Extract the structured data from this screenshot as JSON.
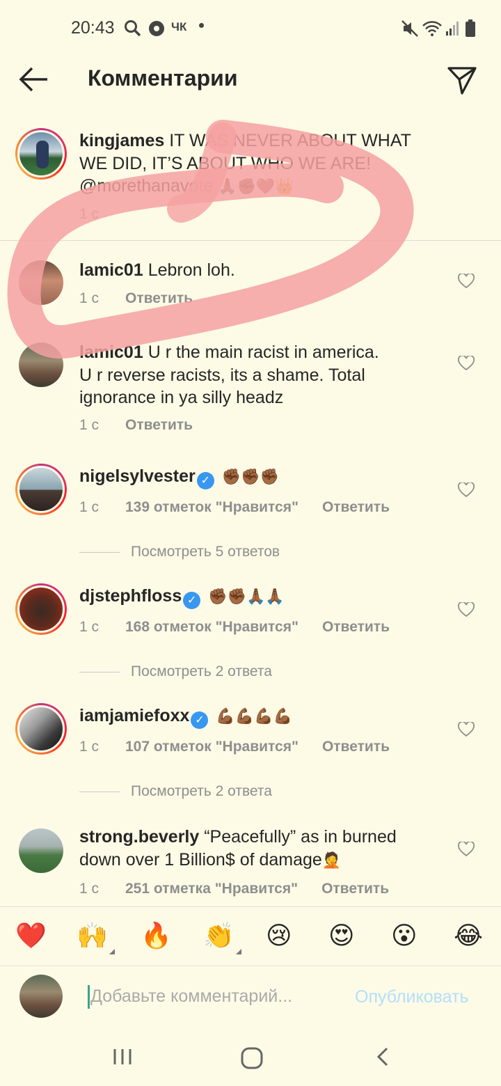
{
  "status_bar": {
    "time": "20:43",
    "carrier_label": "ЧК"
  },
  "header": {
    "title": "Комментарии"
  },
  "caption": {
    "username": "kingjames",
    "text_line1": " IT WAS NEVER ABOUT WHAT",
    "text_line2": "WE DID, IT’S ABOUT WHO WE ARE!",
    "text_line3": "@morethanavote ",
    "emojis": "🙏🏾✊🏾🤎👑",
    "time": "1 с"
  },
  "comments": [
    {
      "username": "lamic01",
      "text": " Lebron loh.",
      "time": "1 с",
      "reply": "Ответить"
    },
    {
      "username": "lamic01",
      "text_line1": " U r the main racist in america.",
      "text_line2": "U r reverse racists, its a shame. Total",
      "text_line3": "ignorance in ya silly headz",
      "time": "1 с",
      "reply": "Ответить"
    },
    {
      "username": "nigelsylvester",
      "verified": true,
      "emojis": "✊🏾✊🏾✊🏾",
      "time": "1 с",
      "likes": "139 отметок \"Нравится\"",
      "reply": "Ответить",
      "view_replies": "Посмотреть 5 ответов"
    },
    {
      "username": "djstephfloss",
      "verified": true,
      "emojis": "✊🏾✊🏾🙏🏾🙏🏾",
      "time": "1 с",
      "likes": "168 отметок \"Нравится\"",
      "reply": "Ответить",
      "view_replies": "Посмотреть 2 ответа"
    },
    {
      "username": "iamjamiefoxx",
      "verified": true,
      "emojis": "💪🏾💪🏾💪🏾💪🏾",
      "time": "1 с",
      "likes": "107 отметок \"Нравится\"",
      "reply": "Ответить",
      "view_replies": "Посмотреть 2 ответа"
    },
    {
      "username": "strong.beverly",
      "text_line1": " “Peacefully” as in burned",
      "text_line2": "down over 1 Billion$ of damage",
      "text_emoji": "🤦",
      "time": "1 с",
      "likes": "251 отметка \"Нравится\"",
      "reply": "Ответить"
    }
  ],
  "emoji_bar": [
    "❤️",
    "🙌",
    "🔥",
    "👏",
    "😢",
    "😍",
    "😮",
    "😂"
  ],
  "input": {
    "placeholder": "Добавьте комментарий...",
    "publish": "Опубликовать"
  },
  "colors": {
    "background": "#fdfbe6",
    "overlay_stroke": "#f3a3a3",
    "link_blue": "#b2dffc",
    "verified": "#3897f0"
  }
}
